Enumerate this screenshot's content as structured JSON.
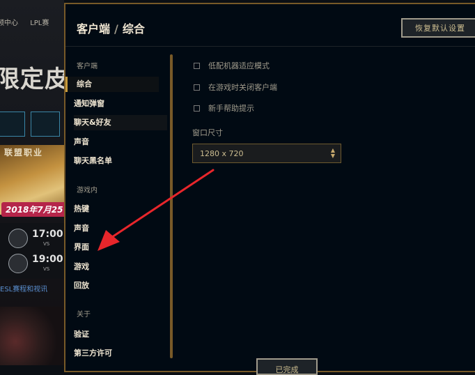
{
  "background": {
    "nav": [
      "频中心",
      "LPL赛"
    ],
    "headline": "限定皮",
    "banner_title": "联盟职业",
    "date": "2018年7月25",
    "matches": [
      {
        "time": "17:00",
        "vs": "VS"
      },
      {
        "time": "19:00",
        "vs": "VS"
      }
    ],
    "link": "ESL赛程和视讯"
  },
  "modal": {
    "breadcrumb_section": "客户端",
    "breadcrumb_separator": "/",
    "breadcrumb_page": "综合",
    "restore_defaults": "恢复默认设置",
    "done": "已完成"
  },
  "sidebar": {
    "sections": [
      {
        "title": "客户端",
        "items": [
          "综合",
          "通知弹窗",
          "聊天&好友",
          "声音",
          "聊天黑名单"
        ]
      },
      {
        "title": "游戏内",
        "items": [
          "热键",
          "声音",
          "界面",
          "游戏",
          "回放"
        ]
      },
      {
        "title": "关于",
        "items": [
          "验证",
          "第三方许可"
        ]
      }
    ],
    "active_item": "综合"
  },
  "settings": {
    "checkboxes": [
      {
        "label": "低配机器适应模式",
        "checked": false
      },
      {
        "label": "在游戏时关闭客户端",
        "checked": false
      },
      {
        "label": "新手帮助提示",
        "checked": false
      }
    ],
    "window_size_label": "窗口尺寸",
    "window_size_value": "1280 x 720"
  },
  "colors": {
    "modal_bg": "#010a13",
    "gold_border": "#785a28",
    "gold_text": "#c8aa6e",
    "annotation_arrow": "#e8262b"
  },
  "icons": {
    "select_chevron": "chevron-up-down-icon",
    "annotation": "red-arrow-icon"
  }
}
